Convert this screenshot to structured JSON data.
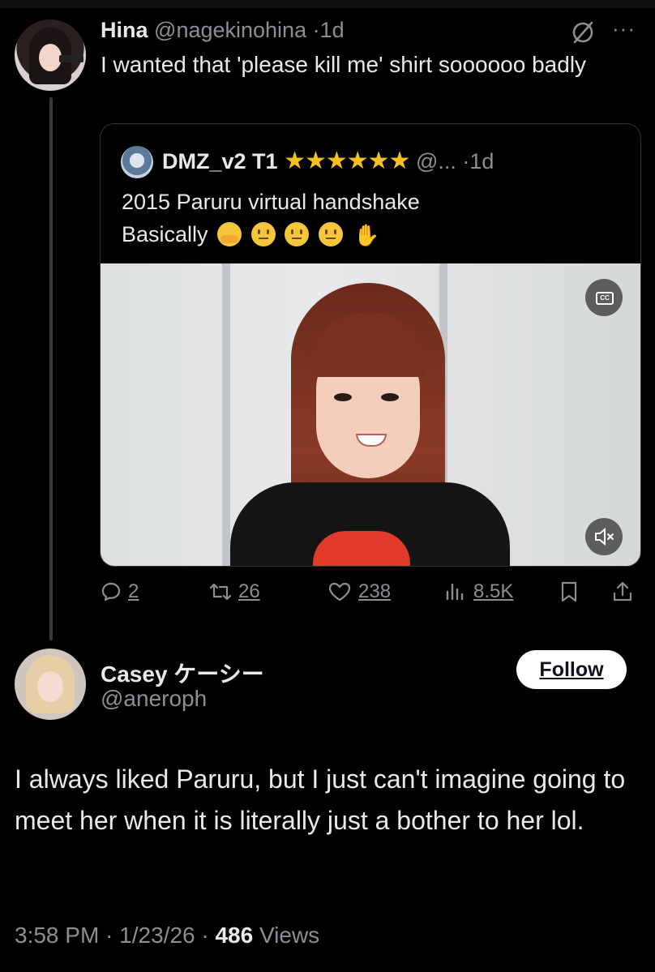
{
  "parent_post": {
    "name": "Hina",
    "handle": "@nagekinohina",
    "dot": "·",
    "time": "1d",
    "text": "I wanted that 'please kill me' shirt soooooo badly",
    "more": "···",
    "icons": [
      "grok-icon",
      "more-icon"
    ]
  },
  "quoted_post": {
    "name": "DMZ_v2 T1",
    "stars": "★★★★★★",
    "handle": "@...",
    "dot": "·",
    "time": "1d",
    "line1": "2015 Paruru virtual handshake",
    "line2": "Basically",
    "emojis": [
      "hugging-face",
      "neutral-face",
      "neutral-face",
      "neutral-face",
      "waving-hand"
    ],
    "video_icons": [
      "closed-captions-icon",
      "mute-icon"
    ]
  },
  "actions": {
    "replies": "2",
    "reposts": "26",
    "likes": "238",
    "views": "8.5K",
    "icons": [
      "reply-icon",
      "repost-icon",
      "like-icon",
      "views-icon",
      "bookmark-icon",
      "share-icon"
    ]
  },
  "reply_post": {
    "name": "Casey ケーシー",
    "handle": "@aneroph",
    "follow_label": "Follow",
    "text": "I always liked Paruru, but I just can't imagine going to meet her when it is literally just a bother to her lol.",
    "time": "3:58 PM",
    "sep": "·",
    "date": "1/23/26",
    "views_count": "486",
    "views_label": "Views"
  },
  "colors": {
    "background": "#000000",
    "text": "#e7e9ea",
    "muted": "#8b8f94",
    "stars": "#f7c021",
    "button_bg": "#ffffff"
  }
}
